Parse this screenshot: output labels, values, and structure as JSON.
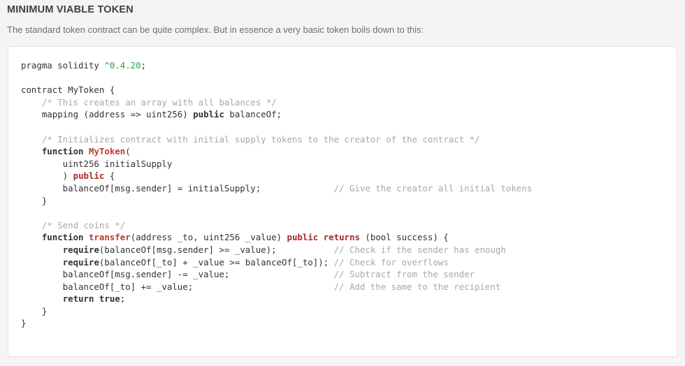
{
  "page": {
    "title": "MINIMUM VIABLE TOKEN",
    "intro": "The standard token contract can be quite complex. But in essence a very basic token boils down to this:"
  },
  "colors": {
    "page_background": "#f4f4f4",
    "code_background": "#ffffff",
    "code_border": "#e3e3e3",
    "title_color": "#3a4149",
    "body_text": "#6d6d6d",
    "code_text": "#333333",
    "comment": "#a8a8a8",
    "keyword_red": "#a52a2a",
    "function_red": "#c0392b",
    "number_green": "#2f9e44"
  },
  "code": {
    "language": "solidity",
    "plain_text": "pragma solidity ^0.4.20;\n\ncontract MyToken {\n    /* This creates an array with all balances */\n    mapping (address => uint256) public balanceOf;\n\n    /* Initializes contract with initial supply tokens to the creator of the contract */\n    function MyToken(\n        uint256 initialSupply\n        ) public {\n        balanceOf[msg.sender] = initialSupply;              // Give the creator all initial tokens\n    }\n\n    /* Send coins */\n    function transfer(address _to, uint256 _value) public returns (bool success) {\n        require(balanceOf[msg.sender] >= _value);           // Check if the sender has enough\n        require(balanceOf[_to] + _value >= balanceOf[_to]); // Check for overflows\n        balanceOf[msg.sender] -= _value;                    // Subtract from the sender\n        balanceOf[_to] += _value;                           // Add the same to the recipient\n        return true;\n    }\n}",
    "lines": [
      {
        "tokens": [
          {
            "t": "pragma solidity ",
            "c": "plain"
          },
          {
            "t": "^0.4.20",
            "c": "number"
          },
          {
            "t": ";",
            "c": "plain"
          }
        ]
      },
      {
        "tokens": [
          {
            "t": "",
            "c": "plain"
          }
        ]
      },
      {
        "tokens": [
          {
            "t": "contract MyToken {",
            "c": "plain"
          }
        ]
      },
      {
        "tokens": [
          {
            "t": "    ",
            "c": "plain"
          },
          {
            "t": "/* This creates an array with all balances */",
            "c": "comment"
          }
        ]
      },
      {
        "tokens": [
          {
            "t": "    mapping (address => uint256) ",
            "c": "plain"
          },
          {
            "t": "public",
            "c": "kw-bold"
          },
          {
            "t": " balanceOf;",
            "c": "plain"
          }
        ]
      },
      {
        "tokens": [
          {
            "t": "",
            "c": "plain"
          }
        ]
      },
      {
        "tokens": [
          {
            "t": "    ",
            "c": "plain"
          },
          {
            "t": "/* Initializes contract with initial supply tokens to the creator of the contract */",
            "c": "comment"
          }
        ]
      },
      {
        "tokens": [
          {
            "t": "    ",
            "c": "plain"
          },
          {
            "t": "function",
            "c": "kw-bold"
          },
          {
            "t": " ",
            "c": "plain"
          },
          {
            "t": "MyToken",
            "c": "fn-red"
          },
          {
            "t": "(",
            "c": "plain"
          }
        ]
      },
      {
        "tokens": [
          {
            "t": "        uint256 initialSupply",
            "c": "plain"
          }
        ]
      },
      {
        "tokens": [
          {
            "t": "        ) ",
            "c": "plain"
          },
          {
            "t": "public",
            "c": "kw-red"
          },
          {
            "t": " {",
            "c": "plain"
          }
        ]
      },
      {
        "tokens": [
          {
            "t": "        balanceOf[msg.sender] = initialSupply;              ",
            "c": "plain"
          },
          {
            "t": "// Give the creator all initial tokens",
            "c": "comment"
          }
        ]
      },
      {
        "tokens": [
          {
            "t": "    }",
            "c": "plain"
          }
        ]
      },
      {
        "tokens": [
          {
            "t": "",
            "c": "plain"
          }
        ]
      },
      {
        "tokens": [
          {
            "t": "    ",
            "c": "plain"
          },
          {
            "t": "/* Send coins */",
            "c": "comment"
          }
        ]
      },
      {
        "tokens": [
          {
            "t": "    ",
            "c": "plain"
          },
          {
            "t": "function",
            "c": "kw-bold"
          },
          {
            "t": " ",
            "c": "plain"
          },
          {
            "t": "transfer",
            "c": "fn-red"
          },
          {
            "t": "(address _to, uint256 _value) ",
            "c": "plain"
          },
          {
            "t": "public",
            "c": "kw-red"
          },
          {
            "t": " ",
            "c": "plain"
          },
          {
            "t": "returns",
            "c": "kw-red"
          },
          {
            "t": " (bool success) {",
            "c": "plain"
          }
        ]
      },
      {
        "tokens": [
          {
            "t": "        ",
            "c": "plain"
          },
          {
            "t": "require",
            "c": "kw-bold"
          },
          {
            "t": "(balanceOf[msg.sender] >= _value);           ",
            "c": "plain"
          },
          {
            "t": "// Check if the sender has enough",
            "c": "comment"
          }
        ]
      },
      {
        "tokens": [
          {
            "t": "        ",
            "c": "plain"
          },
          {
            "t": "require",
            "c": "kw-bold"
          },
          {
            "t": "(balanceOf[_to] + _value >= balanceOf[_to]); ",
            "c": "plain"
          },
          {
            "t": "// Check for overflows",
            "c": "comment"
          }
        ]
      },
      {
        "tokens": [
          {
            "t": "        balanceOf[msg.sender] -= _value;                    ",
            "c": "plain"
          },
          {
            "t": "// Subtract from the sender",
            "c": "comment"
          }
        ]
      },
      {
        "tokens": [
          {
            "t": "        balanceOf[_to] += _value;                           ",
            "c": "plain"
          },
          {
            "t": "// Add the same to the recipient",
            "c": "comment"
          }
        ]
      },
      {
        "tokens": [
          {
            "t": "        ",
            "c": "plain"
          },
          {
            "t": "return",
            "c": "kw-bold"
          },
          {
            "t": " ",
            "c": "plain"
          },
          {
            "t": "true",
            "c": "kw-bold"
          },
          {
            "t": ";",
            "c": "plain"
          }
        ]
      },
      {
        "tokens": [
          {
            "t": "    }",
            "c": "plain"
          }
        ]
      },
      {
        "tokens": [
          {
            "t": "}",
            "c": "plain"
          }
        ]
      }
    ]
  }
}
